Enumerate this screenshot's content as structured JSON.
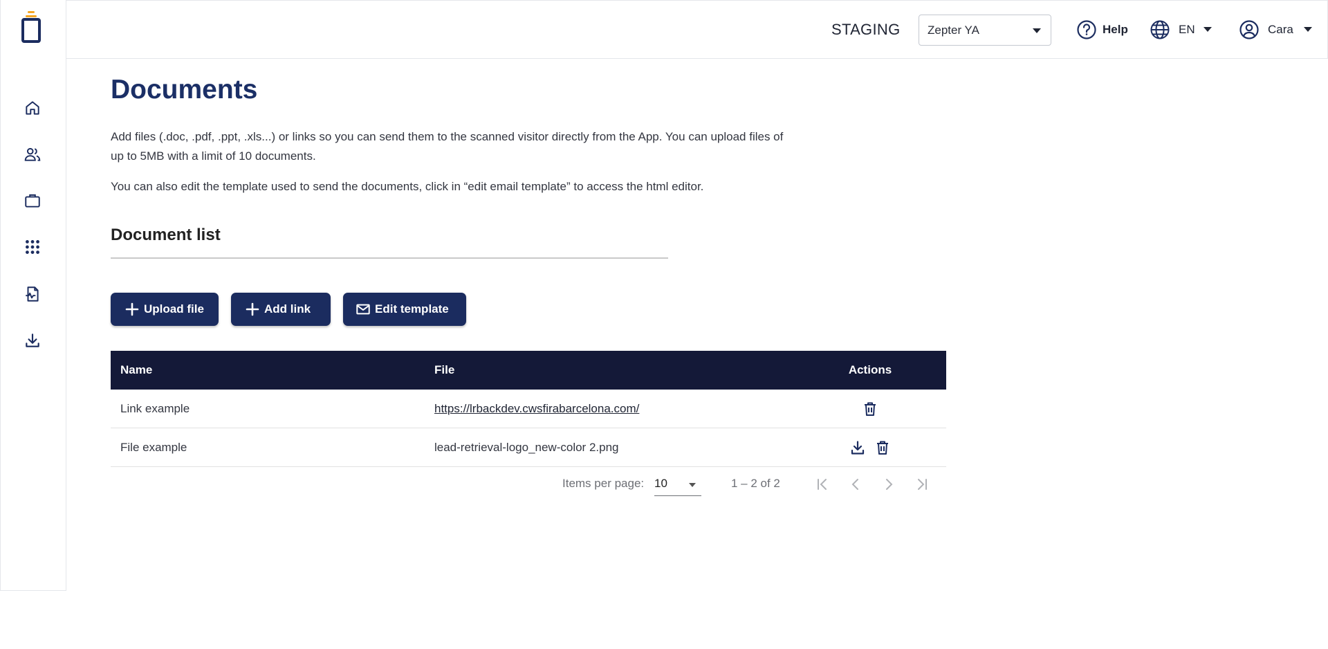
{
  "sidebar": {
    "items": [
      {
        "name": "home-icon"
      },
      {
        "name": "users-icon"
      },
      {
        "name": "briefcase-icon"
      },
      {
        "name": "apps-grid-icon"
      },
      {
        "name": "document-icon"
      },
      {
        "name": "download-icon"
      }
    ]
  },
  "topbar": {
    "environment": "STAGING",
    "event_select": {
      "value": "Zepter YA"
    },
    "help_label": "Help",
    "language": "EN",
    "user": "Cara"
  },
  "main": {
    "title": "Documents",
    "description_1": "Add files (.doc, .pdf, .ppt, .xls...) or links so you can send them to the scanned visitor directly from the App. You can upload files of up to 5MB with a limit of 10 documents.",
    "description_2": "You can also edit the template used to send the documents, click in “edit email template” to access the html editor.",
    "section_title": "Document list",
    "buttons": {
      "upload": "Upload file",
      "add_link": "Add link",
      "edit_template": "Edit template"
    },
    "table": {
      "headers": {
        "name": "Name",
        "file": "File",
        "actions": "Actions"
      },
      "rows": [
        {
          "name": "Link example",
          "file": "https://lrbackdev.cwsfirabarcelona.com/"
        },
        {
          "name": "File example",
          "file": "lead-retrieval-logo_new-color 2.png"
        }
      ]
    },
    "paginator": {
      "items_per_page_label": "Items per page:",
      "items_per_page": "10",
      "range": "1 – 2 of 2"
    }
  },
  "colors": {
    "primary": "#1b2c5f",
    "title": "#1b2f66",
    "table_header": "#141938",
    "logo_accent": "#f5a623"
  }
}
